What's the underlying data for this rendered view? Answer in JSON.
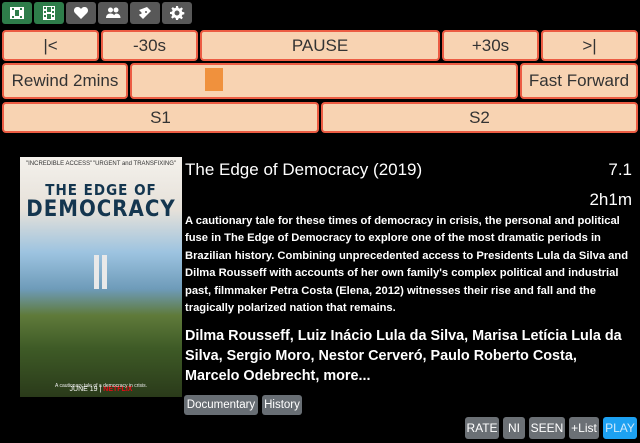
{
  "toolbar": {
    "icons": [
      "film-icon",
      "filmstrip-icon",
      "heart-icon",
      "people-icon",
      "ticket-icon",
      "gear-icon"
    ]
  },
  "controls": {
    "skip_back": "|<",
    "back_30": "-30s",
    "pause": "PAUSE",
    "forward_30": "+30s",
    "skip_forward": ">|",
    "rewind_2min": "Rewind 2mins",
    "fast_forward": "Fast Forward",
    "position": 0.2,
    "season_1": "S1",
    "season_2": "S2"
  },
  "movie": {
    "title": "The Edge of Democracy (2019)",
    "rating": "7.1",
    "runtime": "2h1m",
    "description": "A cautionary tale for these times of democracy in crisis, the personal and political fuse in The Edge of Democracy to explore one of the most dramatic periods in Brazilian history. Combining unprecedented access to Presidents Lula da Silva and Dilma Rousseff with accounts of her own family's complex political and industrial past, filmmaker Petra Costa (Elena, 2012) witnesses their rise and fall and the tragically polarized nation that remains.",
    "cast": "Dilma Rousseff, Luiz Inácio Lula da Silva, Marisa Letícia Lula da Silva, Sergio Moro, Nestor Cerveró, Paulo Roberto Costa, Marcelo Odebrecht, more...",
    "genres": [
      "Documentary",
      "History"
    ],
    "poster": {
      "quote_left": "\"INCREDIBLE ACCESS\"",
      "quote_right": "\"URGENT and TRANSFIXING\"",
      "title_line1": "THE EDGE OF",
      "title_line2": "DEMOCRACY",
      "tagline": "A cautionary tale of a democracy in crisis.",
      "date": "JUNE 19",
      "brand": "NETFLIX"
    }
  },
  "actions": {
    "rate": "RATE",
    "ni": "NI",
    "seen": "SEEN",
    "list": "+List",
    "play": "PLAY"
  }
}
